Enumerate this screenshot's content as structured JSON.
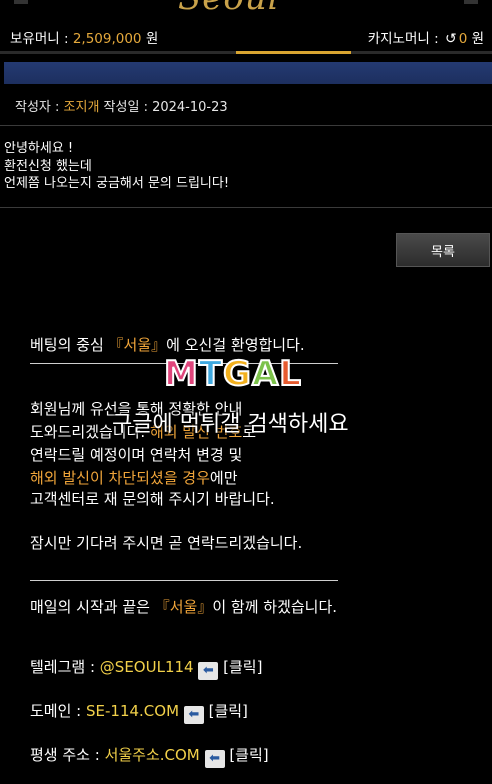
{
  "brand": {
    "logo_text": "Seoul"
  },
  "money_bar": {
    "balance_label": "보유머니 : ",
    "balance_value": "2,509,000",
    "balance_unit": " 원",
    "casino_label": "카지노머니 : ",
    "casino_value": "0",
    "casino_unit": " 원"
  },
  "post": {
    "author_label": "작성자 : ",
    "author": "조지개",
    "date_label": " 작성일 : ",
    "date": "2024-10-23",
    "lines": [
      "안녕하세요 !",
      "환전신청 했는데",
      "언제쯤 나오는지 궁금해서 문의 드립니다!"
    ]
  },
  "list_button": "목록",
  "reply": {
    "welcome_pre": "베팅의 중심 ",
    "welcome_brand": "『서울』",
    "welcome_post": "에 오신걸 환영합니다.",
    "p1": "회원님께 유선을 통해 정확한 안내",
    "p2_pre": "도와드리겠습니다. ",
    "p2_hl": "해외 발신 번호",
    "p2_post": "로",
    "p3": "연락드릴 예정이며 연락처 변경 및",
    "p4_hl": "해외 발신이 차단되셨을 경우",
    "p4_post": "에만",
    "p5": "고객센터로 재 문의해 주시기 바랍니다.",
    "wait": "잠시만 기다려 주시면 곧 연락드리겠습니다.",
    "daily_pre": "매일의 시작과 끝은 ",
    "daily_brand": "『서울』",
    "daily_post": "이 함께 하겠습니다.",
    "telegram_label": "텔레그램 : ",
    "telegram_value": "@SEOUL114",
    "domain_label": "도메인 : ",
    "domain_value": "SE-114.COM",
    "lifetime_label": "평생 주소 : ",
    "lifetime_value": "서울주소.COM",
    "click_label": " [클릭]",
    "arrow_glyph": "⬅"
  },
  "watermark": {
    "logo_letters": [
      "M",
      "T",
      "G",
      "A",
      "L"
    ],
    "logo_colors": [
      "#e0457b",
      "#3fa9e0",
      "#f2b01e",
      "#7cc24a",
      "#e65a2e"
    ],
    "text": "구글에 먹튀갤 검색하세요"
  }
}
